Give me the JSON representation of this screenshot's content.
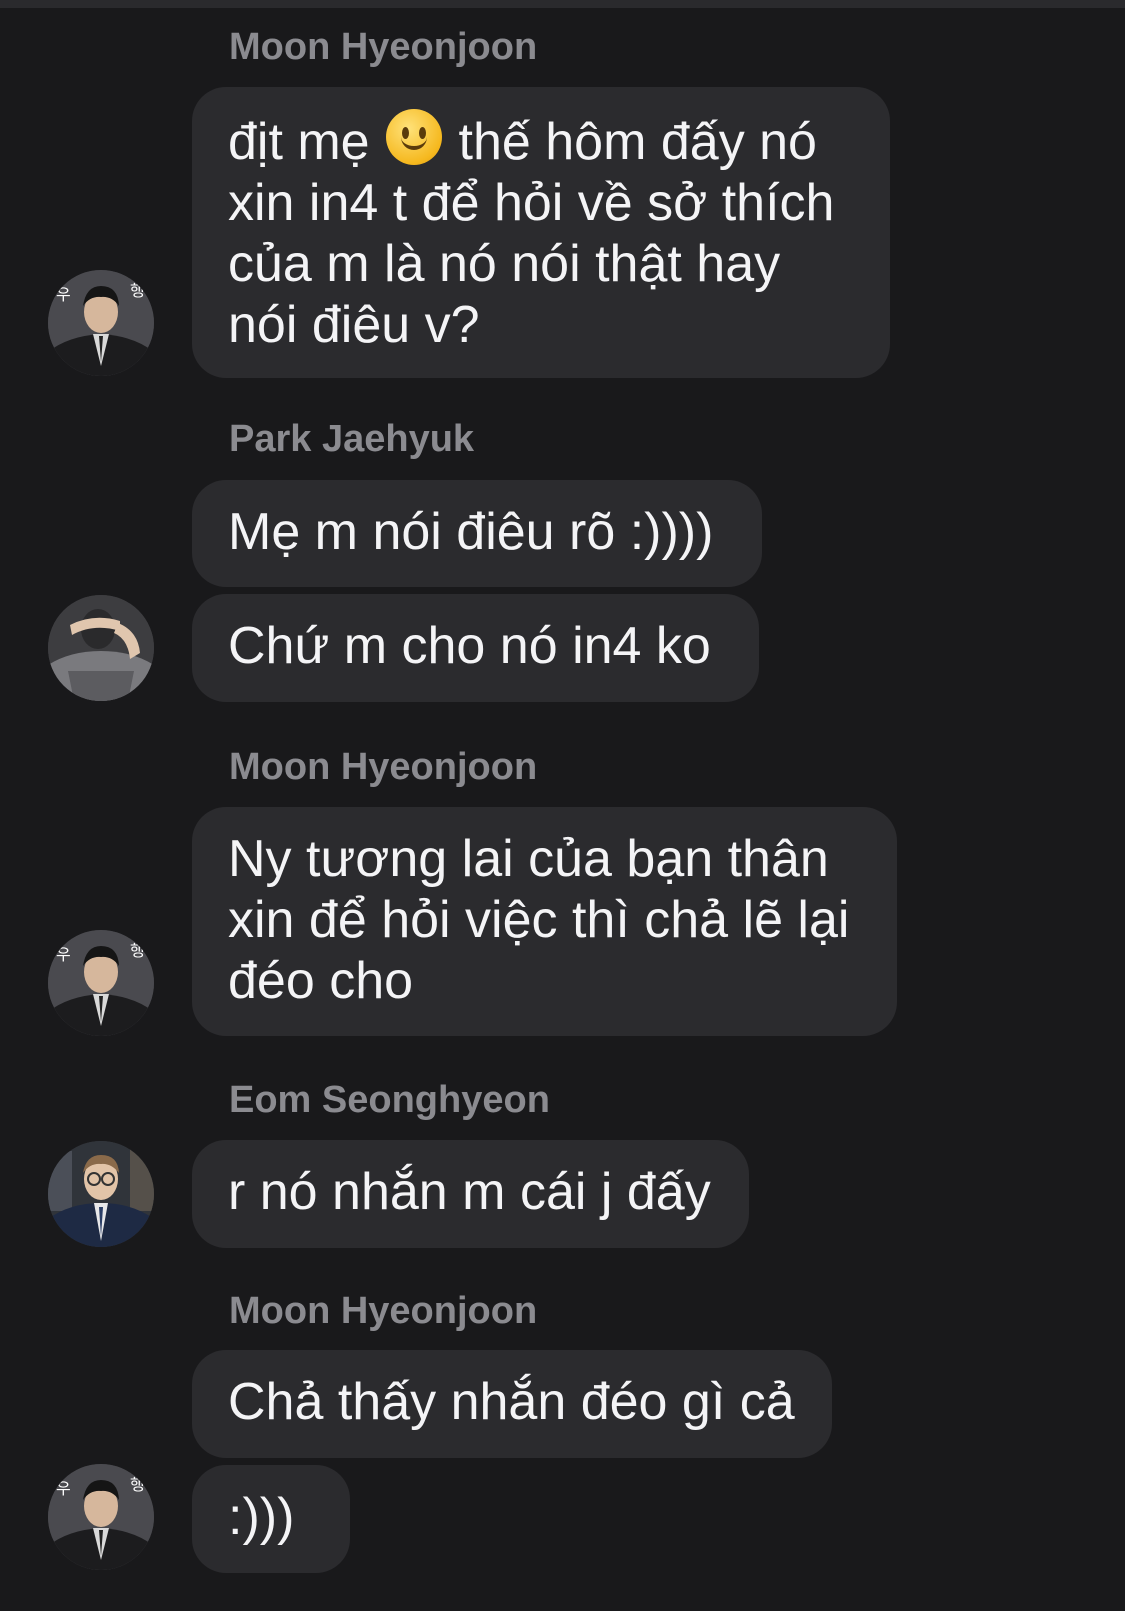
{
  "chat": {
    "groups": [
      {
        "sender": "Moon Hyeonjoon",
        "avatar_icon": "profile-photo-suit",
        "messages": [
          {
            "pre": "địt mẹ ",
            "emoji": "slightly-smiling-face-emoji",
            "post": " thế hôm đấy nó\nxin in4 t để hỏi về sở thích\ncủa m là nó nói thật hay\nnói điêu v?"
          }
        ]
      },
      {
        "sender": "Park Jaehyuk",
        "avatar_icon": "profile-photo-hand-over-face",
        "messages": [
          {
            "text": "Mẹ m nói điêu rõ :))))"
          },
          {
            "text": "Chứ m cho nó in4 ko"
          }
        ]
      },
      {
        "sender": "Moon Hyeonjoon",
        "avatar_icon": "profile-photo-suit",
        "messages": [
          {
            "text": "Ny tương lai của bạn thân\nxin để hỏi việc thì chả lẽ lại\nđéo cho"
          }
        ]
      },
      {
        "sender": "Eom Seonghyeon",
        "avatar_icon": "profile-photo-glasses",
        "messages": [
          {
            "text": "r nó nhắn m cái j đấy"
          }
        ]
      },
      {
        "sender": "Moon Hyeonjoon",
        "avatar_icon": "profile-photo-suit",
        "messages": [
          {
            "text": "Chả thấy nhắn đéo gì cả"
          },
          {
            "text": ":)))"
          }
        ]
      }
    ]
  },
  "colors": {
    "background": "#19191b",
    "bubble": "#2b2b2e",
    "sender_name": "#8b8b90",
    "message_text": "#f4f4f6"
  }
}
